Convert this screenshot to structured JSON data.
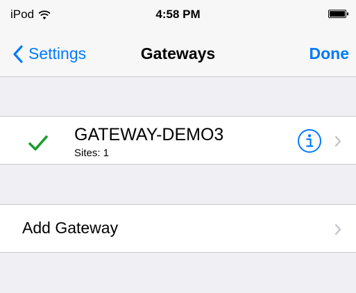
{
  "status_bar": {
    "carrier": "iPod",
    "time": "4:58 PM"
  },
  "nav": {
    "back_label": "Settings",
    "title": "Gateways",
    "done_label": "Done"
  },
  "gateways": [
    {
      "name": "GATEWAY-DEMO3",
      "subtitle": "Sites: 1",
      "selected": true
    }
  ],
  "add_gateway_label": "Add Gateway",
  "colors": {
    "accent": "#007aff",
    "check": "#1a9e2f",
    "background": "#efeff4",
    "chevron": "#c7c7cc"
  },
  "icons": [
    "wifi-icon",
    "battery-icon",
    "chevron-left-icon",
    "checkmark-icon",
    "info-icon",
    "chevron-right-icon"
  ]
}
